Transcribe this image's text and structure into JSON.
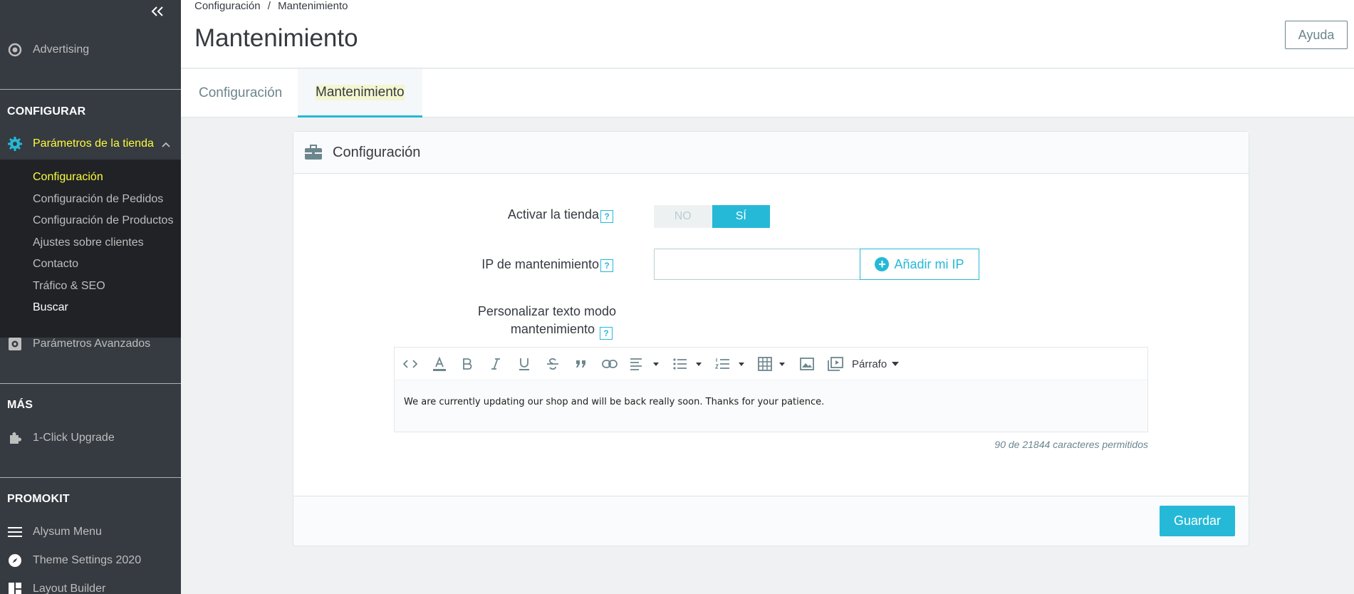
{
  "sidebar": {
    "top_items": [
      {
        "label": "Advertising",
        "icon": "target-icon"
      }
    ],
    "sections": [
      {
        "heading": "CONFIGURAR"
      },
      {
        "heading": "MÁS"
      },
      {
        "heading": "PROMOKIT"
      }
    ],
    "parametros": {
      "label": "Parámetros de la tienda",
      "icon": "gear-icon",
      "subitems": [
        "Configuración",
        "Configuración de Pedidos",
        "Configuración de Productos",
        "Ajustes sobre clientes",
        "Contacto",
        "Tráfico & SEO",
        "Buscar"
      ]
    },
    "avanzados": {
      "label": "Parámetros Avanzados",
      "icon": "cog-box-icon"
    },
    "upgrade": {
      "label": "1-Click Upgrade",
      "icon": "puzzle-icon"
    },
    "promokit_items": [
      {
        "label": "Alysum Menu",
        "icon": "menu-icon"
      },
      {
        "label": "Theme Settings 2020",
        "icon": "compass-icon"
      },
      {
        "label": "Layout Builder",
        "icon": "layout-icon"
      }
    ]
  },
  "header": {
    "breadcrumb": [
      "Configuración",
      "/",
      "Mantenimiento"
    ],
    "title": "Mantenimiento",
    "help_label": "Ayuda"
  },
  "tabs": [
    "Configuración",
    "Mantenimiento"
  ],
  "panel": {
    "title": "Configuración",
    "activar_label": "Activar la tienda",
    "toggle_no": "NO",
    "toggle_si": "SÍ",
    "ip_label": "IP de mantenimiento",
    "ip_value": "",
    "ip_button": "Añadir mi IP",
    "texto_label_1": "Personalizar texto modo",
    "texto_label_2": "mantenimiento",
    "help_mark": "?",
    "editor_format": "Párrafo",
    "editor_text": "We are currently updating our shop and will be back really soon. Thanks for your patience.",
    "char_count": "90 de 21844 caracteres permitidos",
    "save_label": "Guardar"
  },
  "colors": {
    "accent": "#25b9d7",
    "sidebar_bg": "#363a41",
    "highlight": "#fcfc3c"
  }
}
